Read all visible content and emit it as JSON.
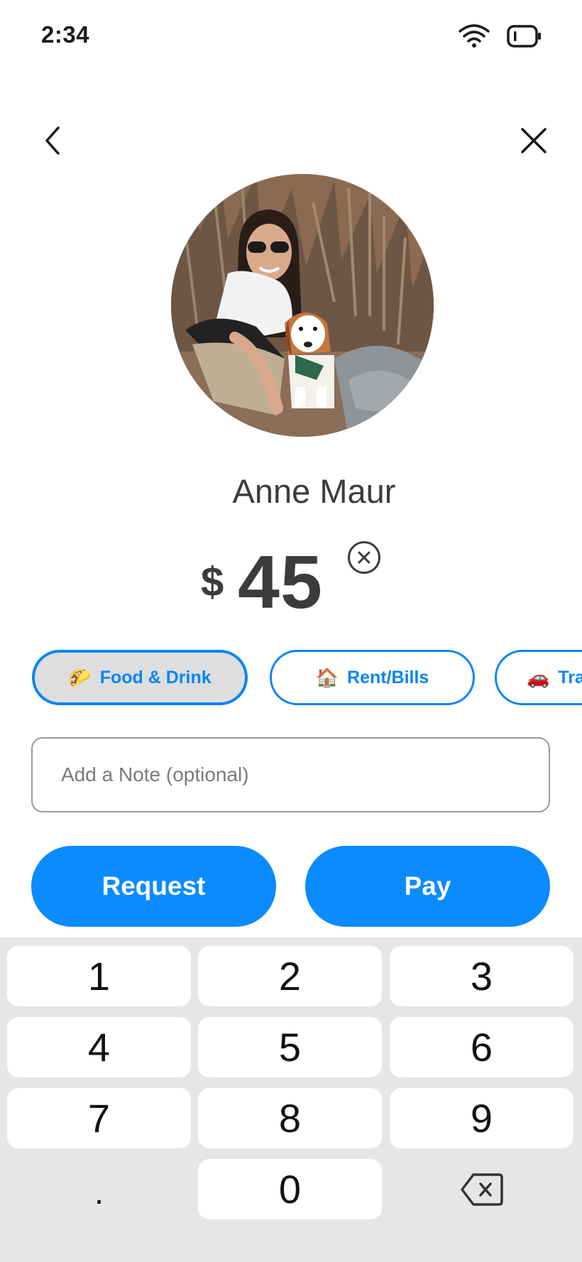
{
  "status_bar": {
    "time": "2:34",
    "icons": [
      "wifi-icon",
      "battery-icon"
    ]
  },
  "nav": {
    "back_icon": "chevron-left-icon",
    "close_icon": "close-icon"
  },
  "recipient": {
    "name": "Anne Maur",
    "avatar": "profile-photo"
  },
  "amount": {
    "currency": "$",
    "value": "45",
    "clear_icon": "clear-circle-icon"
  },
  "categories": [
    {
      "emoji": "🌮",
      "label": "Food & Drink",
      "selected": true
    },
    {
      "emoji": "🏠",
      "label": "Rent/Bills",
      "selected": false
    },
    {
      "emoji": "🚗",
      "label": "Tran",
      "selected": false
    }
  ],
  "note": {
    "placeholder": "Add a Note (optional)",
    "value": ""
  },
  "actions": {
    "request_label": "Request",
    "pay_label": "Pay"
  },
  "keypad": {
    "keys": [
      "1",
      "2",
      "3",
      "4",
      "5",
      "6",
      "7",
      "8",
      "9",
      ".",
      "0"
    ],
    "backspace_icon": "backspace-icon"
  },
  "colors": {
    "accent": "#0a8bff",
    "chip_border": "#0a84f5",
    "text": "#3c3c3c",
    "keypad_bg": "#e6e6e6"
  }
}
